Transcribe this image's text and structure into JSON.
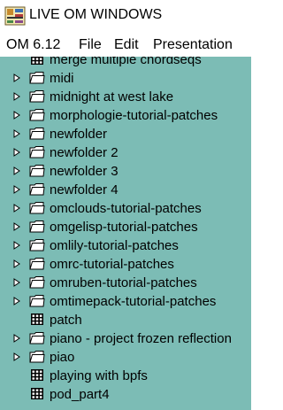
{
  "window": {
    "title": "LIVE OM WINDOWS"
  },
  "menubar": {
    "items": [
      "OM 6.12",
      "File",
      "Edit",
      "Presentation"
    ]
  },
  "browser": {
    "background_color": "#7cbcb5",
    "items": [
      {
        "label": "merge multiple chordseqs",
        "type": "patch",
        "expandable": false
      },
      {
        "label": "midi",
        "type": "folder",
        "expandable": true
      },
      {
        "label": "midnight at west lake",
        "type": "folder",
        "expandable": true
      },
      {
        "label": "morphologie-tutorial-patches",
        "type": "folder",
        "expandable": true
      },
      {
        "label": "newfolder",
        "type": "folder",
        "expandable": true
      },
      {
        "label": "newfolder 2",
        "type": "folder",
        "expandable": true
      },
      {
        "label": "newfolder 3",
        "type": "folder",
        "expandable": true
      },
      {
        "label": "newfolder 4",
        "type": "folder",
        "expandable": true
      },
      {
        "label": "omclouds-tutorial-patches",
        "type": "folder",
        "expandable": true
      },
      {
        "label": "omgelisp-tutorial-patches",
        "type": "folder",
        "expandable": true
      },
      {
        "label": "omlily-tutorial-patches",
        "type": "folder",
        "expandable": true
      },
      {
        "label": "omrc-tutorial-patches",
        "type": "folder",
        "expandable": true
      },
      {
        "label": "omruben-tutorial-patches",
        "type": "folder",
        "expandable": true
      },
      {
        "label": "omtimepack-tutorial-patches",
        "type": "folder",
        "expandable": true
      },
      {
        "label": "patch",
        "type": "patch",
        "expandable": false
      },
      {
        "label": "piano - project frozen reflection",
        "type": "folder",
        "expandable": true
      },
      {
        "label": "piao",
        "type": "folder",
        "expandable": true
      },
      {
        "label": "playing with bpfs",
        "type": "patch",
        "expandable": false
      },
      {
        "label": "pod_part4",
        "type": "patch",
        "expandable": false
      }
    ]
  }
}
